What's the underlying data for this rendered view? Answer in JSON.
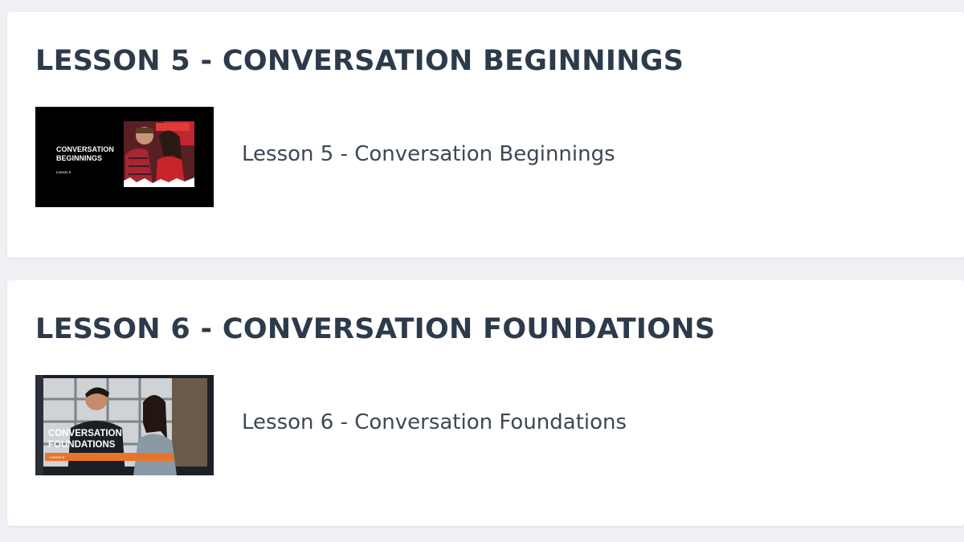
{
  "lessons": [
    {
      "heading": "LESSON 5 - CONVERSATION BEGINNINGS",
      "link_label": "Lesson 5 - Conversation Beginnings",
      "thumbnail": {
        "title_line1": "CONVERSATION",
        "title_line2": "BEGINNINGS",
        "subtitle": "Lesson 5",
        "background": "#000000"
      }
    },
    {
      "heading": "LESSON 6 - CONVERSATION FOUNDATIONS",
      "link_label": "Lesson 6 - Conversation Foundations",
      "thumbnail": {
        "title_line1": "CONVERSATION",
        "title_line2": "FOUNDATIONS",
        "subtitle": "Lesson 6",
        "accent": "#e8742c"
      }
    }
  ],
  "colors": {
    "page_bg": "#eef0f3",
    "card_bg": "#ffffff",
    "heading": "#2d3a4b",
    "link": "#3d4756"
  }
}
